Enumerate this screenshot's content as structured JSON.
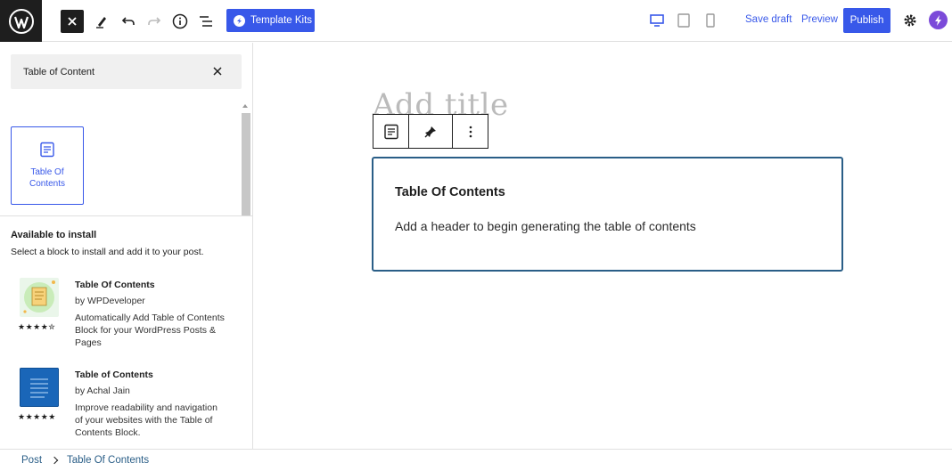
{
  "topbar": {
    "template_kits_label": "Template Kits",
    "save_draft_label": "Save draft",
    "preview_label": "Preview",
    "publish_label": "Publish"
  },
  "sidebar": {
    "search_value": "Table of Content",
    "block_result_label_line1": "Table Of",
    "block_result_label_line2": "Contents",
    "available_title": "Available to install",
    "available_subtitle": "Select a block to install and add it to your post.",
    "plugins": [
      {
        "name": "Table Of Contents",
        "author": "by WPDeveloper",
        "description": "Automatically Add Table of Contents Block for your WordPress Posts & Pages",
        "rating": "★★★★✮"
      },
      {
        "name": "Table of Contents",
        "author": "by Achal Jain",
        "description": "Improve readability and navigation of your websites with the Table of Contents Block.",
        "rating": "★★★★★"
      }
    ]
  },
  "editor": {
    "title_placeholder": "Add title",
    "toc_heading": "Table Of Contents",
    "toc_message": "Add a header to begin generating the table of contents"
  },
  "breadcrumb": {
    "items": [
      "Post",
      "Table Of Contents"
    ]
  },
  "colors": {
    "accent": "#3858e9",
    "dark": "#1e1e1e",
    "block_border": "#2a5e87"
  }
}
